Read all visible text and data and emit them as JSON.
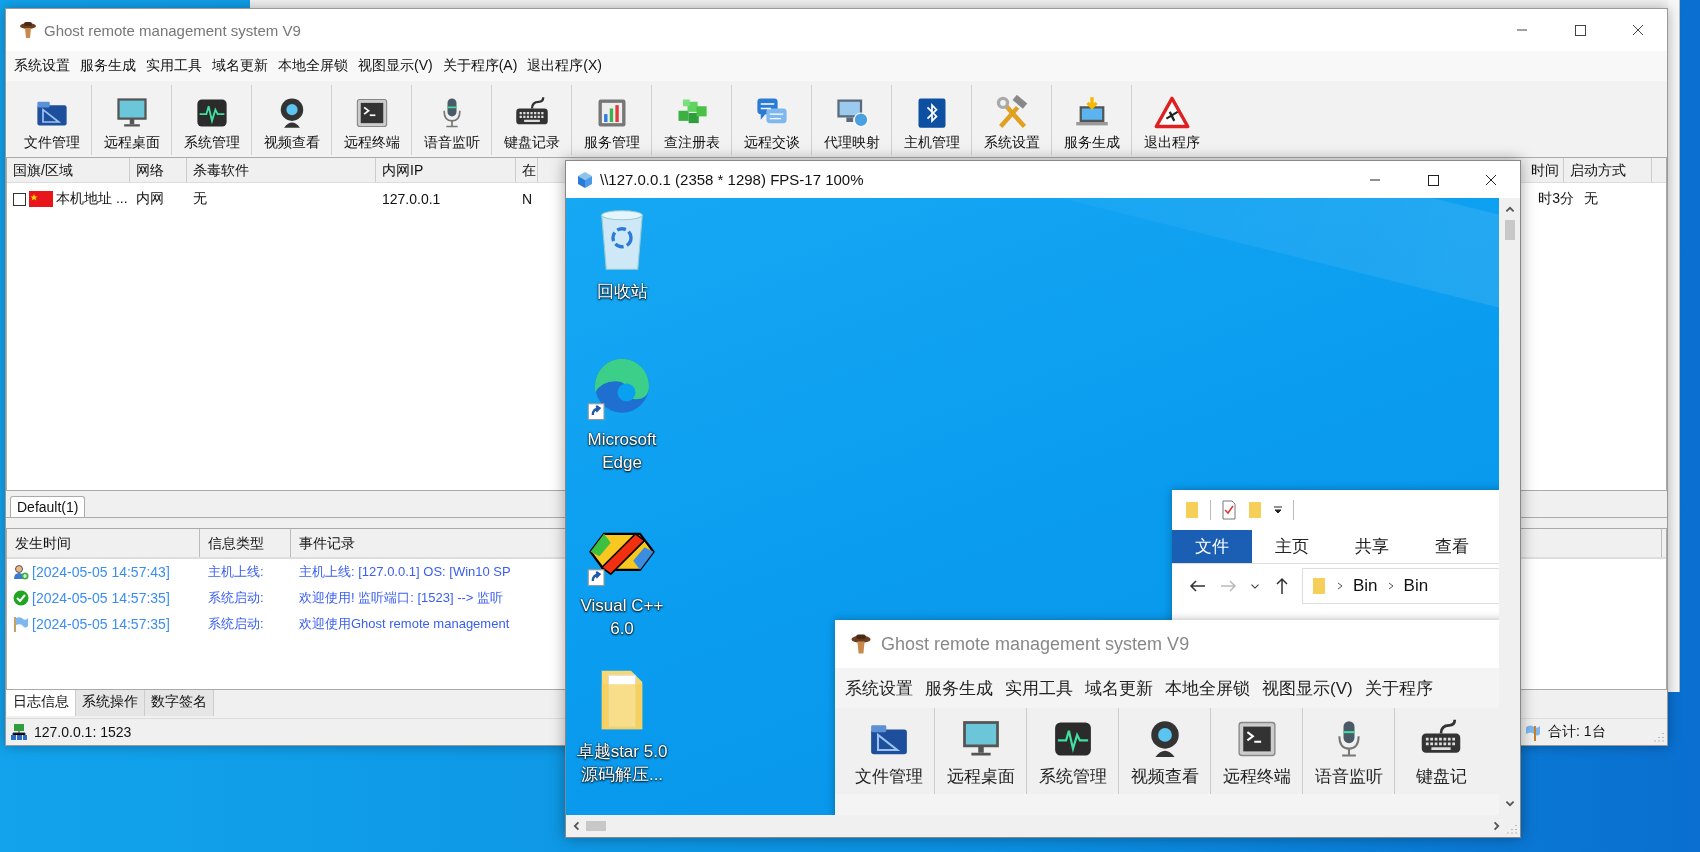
{
  "window": {
    "title": "Ghost remote management system V9"
  },
  "menu": [
    "系统设置",
    "服务生成",
    "实用工具",
    "域名更新",
    "本地全屏锁",
    "视图显示(V)",
    "关于程序(A)",
    "退出程序(X)"
  ],
  "toolbar": [
    "文件管理",
    "远程桌面",
    "系统管理",
    "视频查看",
    "远程终端",
    "语音监听",
    "键盘记录",
    "服务管理",
    "查注册表",
    "远程交谈",
    "代理映射",
    "主机管理",
    "系统设置",
    "服务生成",
    "退出程序"
  ],
  "host_list": {
    "columns": [
      "国旗/区域",
      "网络",
      "杀毒软件",
      "内网IP",
      "在",
      "时间",
      "启动方式"
    ],
    "rows": [
      {
        "checked": false,
        "cells": [
          "本机地址 ...",
          "内网",
          "无",
          "127.0.0.1",
          "N",
          "时3分",
          "无"
        ]
      }
    ]
  },
  "group_tabs": [
    {
      "label": "Default(1)",
      "selected": true
    }
  ],
  "log": {
    "columns": [
      "发生时间",
      "信息类型",
      "事件记录"
    ],
    "rows": [
      {
        "kind": "online",
        "time": "[2024-05-05 14:57:43]",
        "type": "主机上线:",
        "event": "主机上线: [127.0.0.1]   OS: [Win10 SP"
      },
      {
        "kind": "ok",
        "time": "[2024-05-05 14:57:35]",
        "type": "系统启动:",
        "event": "欢迎使用!  监听端口: [1523] --> 监听"
      },
      {
        "kind": "flag",
        "time": "[2024-05-05 14:57:35]",
        "type": "系统启动:",
        "event": "欢迎使用Ghost remote management"
      }
    ]
  },
  "bottom_tabs": [
    {
      "label": "日志信息",
      "selected": true
    },
    {
      "label": "系统操作",
      "selected": false
    },
    {
      "label": "数字签名",
      "selected": false
    }
  ],
  "status_bar": {
    "left": "127.0.0.1: 1523",
    "right": "合计: 1台"
  },
  "remote_window": {
    "title": "\\\\127.0.0.1 (2358 * 1298) FPS-17 100%",
    "desktop_icons": [
      {
        "kind": "recycle-bin",
        "label": "回收站",
        "shortcut": false
      },
      {
        "kind": "edge",
        "label": "Microsoft Edge",
        "shortcut": true
      },
      {
        "kind": "vcpp",
        "label": "Visual C++ 6.0",
        "shortcut": true
      },
      {
        "kind": "folder",
        "label": "卓越star 5.0 源码解压...",
        "shortcut": false
      }
    ],
    "explorer": {
      "ribbon_tabs": [
        {
          "label": "文件",
          "selected": true
        },
        {
          "label": "主页",
          "selected": false
        },
        {
          "label": "共享",
          "selected": false
        },
        {
          "label": "查看",
          "selected": false
        }
      ],
      "path": [
        "Bin",
        "Bin"
      ]
    },
    "nested_app": {
      "title": "Ghost remote management system V9",
      "menu": [
        "系统设置",
        "服务生成",
        "实用工具",
        "域名更新",
        "本地全屏锁",
        "视图显示(V)",
        "关于程序"
      ],
      "toolbar": [
        "文件管理",
        "远程桌面",
        "系统管理",
        "视频查看",
        "远程终端",
        "语音监听",
        "键盘记"
      ]
    }
  }
}
